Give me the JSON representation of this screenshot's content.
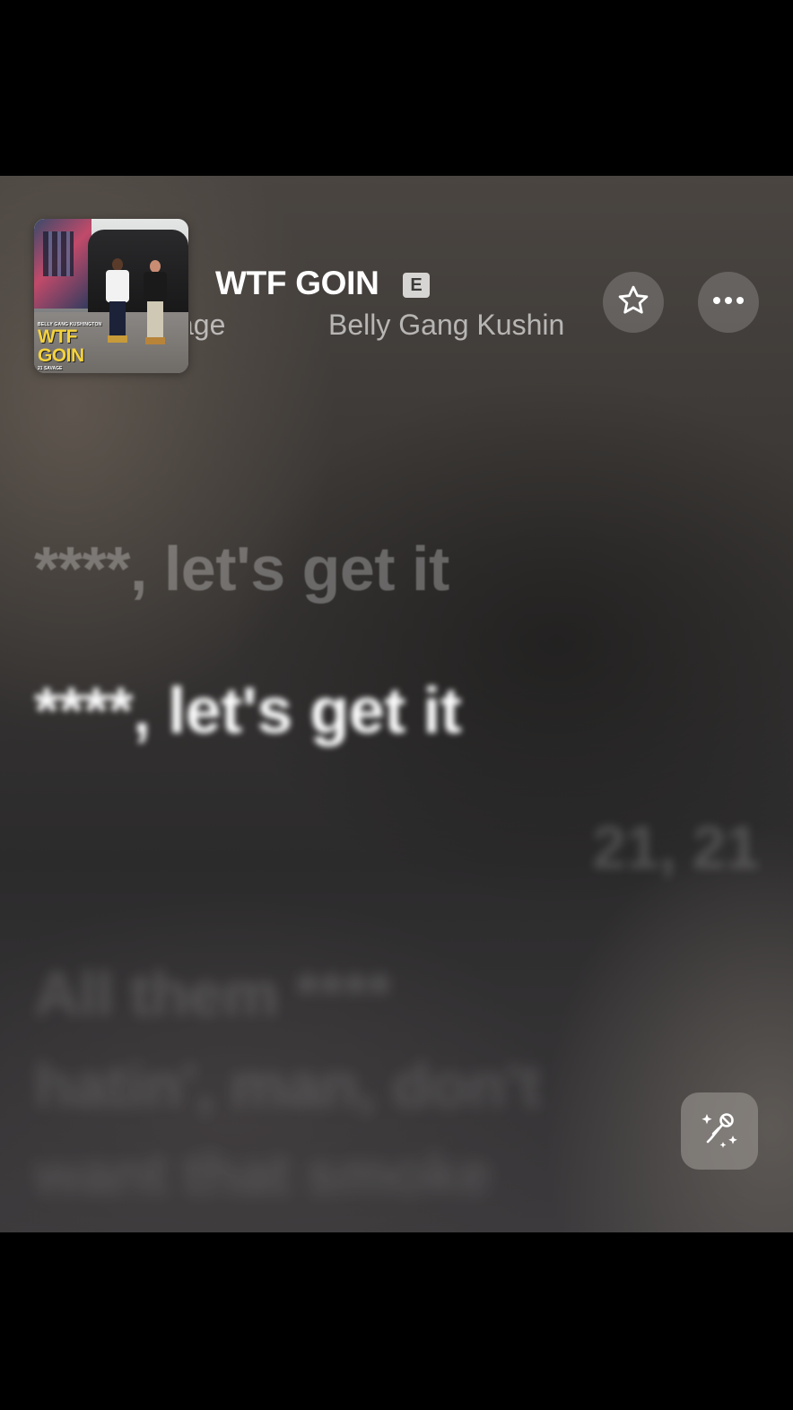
{
  "track": {
    "title": "WTF GOIN",
    "explicit_badge": "E",
    "artists_visible": [
      "vage",
      "Belly Gang Kushin"
    ],
    "artwork": {
      "label_top": "BELLY GANG KUSHINGTON",
      "label_title_1": "WTF",
      "label_title_2": "GOIN",
      "label_bottom": "21 SAVAGE"
    }
  },
  "controls": {
    "favorite_icon": "star-outline-icon",
    "more_icon": "ellipsis-icon",
    "sing_icon": "microphone-sparkles-icon"
  },
  "lyrics": {
    "previous": "****, let's get it",
    "current": "****, let's get it",
    "adlib": "21, 21",
    "upcoming": [
      "All them ****",
      "hatin', man, don't",
      "want that smoke"
    ]
  },
  "colors": {
    "background_top": "#4a4541",
    "background_bottom": "#3c3a3c",
    "text_primary": "#ffffff",
    "explicit_badge_bg": "#d7d5d3"
  }
}
